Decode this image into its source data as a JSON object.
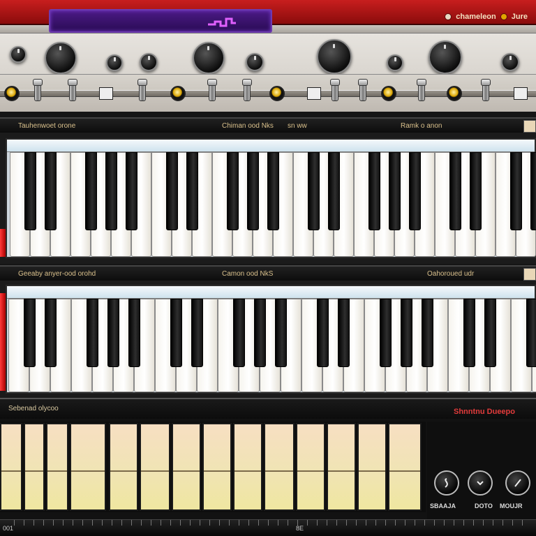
{
  "top_bar": {
    "display_text": "",
    "brand_text": "chameleon",
    "brand_suffix": "Jure"
  },
  "control_panel": {
    "label_left": "",
    "label_right": ""
  },
  "keyboard_upper": {
    "header_left": "Tauhenwoet orone",
    "header_center": "Chiman ood Nks",
    "header_center_suffix": "sn ww",
    "header_right": "Ramk o anon"
  },
  "keyboard_lower": {
    "header_left": "Geeaby anyer-ood orohd",
    "header_center": "Camon ood NkS",
    "header_right": "Oahoroued udr"
  },
  "sequencer": {
    "title": "Sebenad olycoo",
    "brand": "Shnntnu Dueepo",
    "mode_labels": [
      "SBAAJA",
      "DOTO",
      "MOUJR"
    ],
    "footer_left": "001",
    "footer_mid": "8E"
  },
  "colors": {
    "accent_red": "#c81e1e",
    "display_purple": "#4b1a85",
    "pad_cream": "#f3e2b8"
  }
}
